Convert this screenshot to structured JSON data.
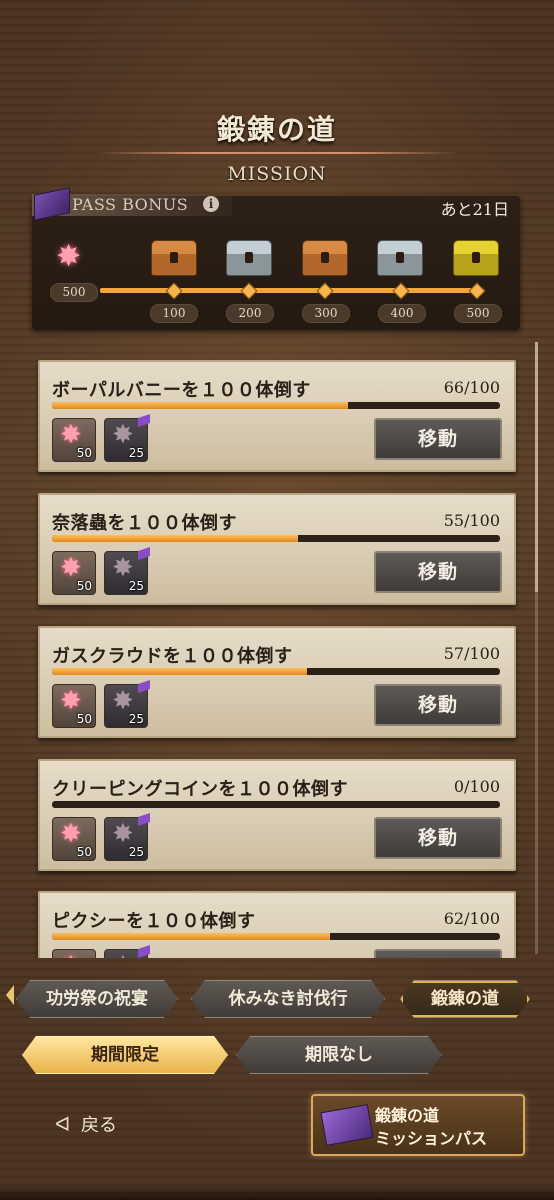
{
  "header": {
    "title": "鍛錬の道",
    "subtitle": "MISSION"
  },
  "pass_bonus": {
    "label": "PASS BONUS",
    "info_icon": "i",
    "remaining": "あと21日",
    "current_points": "500",
    "milestones": [
      {
        "points": "100",
        "chest": "bronze-chest-icon"
      },
      {
        "points": "200",
        "chest": "silver-chest-icon"
      },
      {
        "points": "300",
        "chest": "bronze-chest-icon"
      },
      {
        "points": "400",
        "chest": "silver-chest-icon"
      },
      {
        "points": "500",
        "chest": "gold-chest-icon"
      }
    ]
  },
  "missions": [
    {
      "name": "ボーパルバニーを１００体倒す",
      "progress": "66/100",
      "fraction": 0.66,
      "reward1": "50",
      "reward2": "25",
      "button": "移動"
    },
    {
      "name": "奈落蟲を１００体倒す",
      "progress": "55/100",
      "fraction": 0.55,
      "reward1": "50",
      "reward2": "25",
      "button": "移動"
    },
    {
      "name": "ガスクラウドを１００体倒す",
      "progress": "57/100",
      "fraction": 0.57,
      "reward1": "50",
      "reward2": "25",
      "button": "移動"
    },
    {
      "name": "クリーピングコインを１００体倒す",
      "progress": "0/100",
      "fraction": 0.0,
      "reward1": "50",
      "reward2": "25",
      "button": "移動"
    },
    {
      "name": "ピクシーを１００体倒す",
      "progress": "62/100",
      "fraction": 0.62,
      "reward1": "50",
      "reward2": "25",
      "button": "移動"
    }
  ],
  "tabs_row1": [
    "功労祭の祝宴",
    "休みなき討伐行",
    "鍛錬の道"
  ],
  "tabs_row2": [
    "期間限定",
    "期限なし"
  ],
  "footer": {
    "back_label": "戻る",
    "pass_line1": "鍛錬の道",
    "pass_line2": "ミッションパス"
  },
  "colors": {
    "progress_fill": "#f2a53a",
    "accent_gold": "#e9b34b",
    "pass_purple": "#7a4fb0"
  }
}
